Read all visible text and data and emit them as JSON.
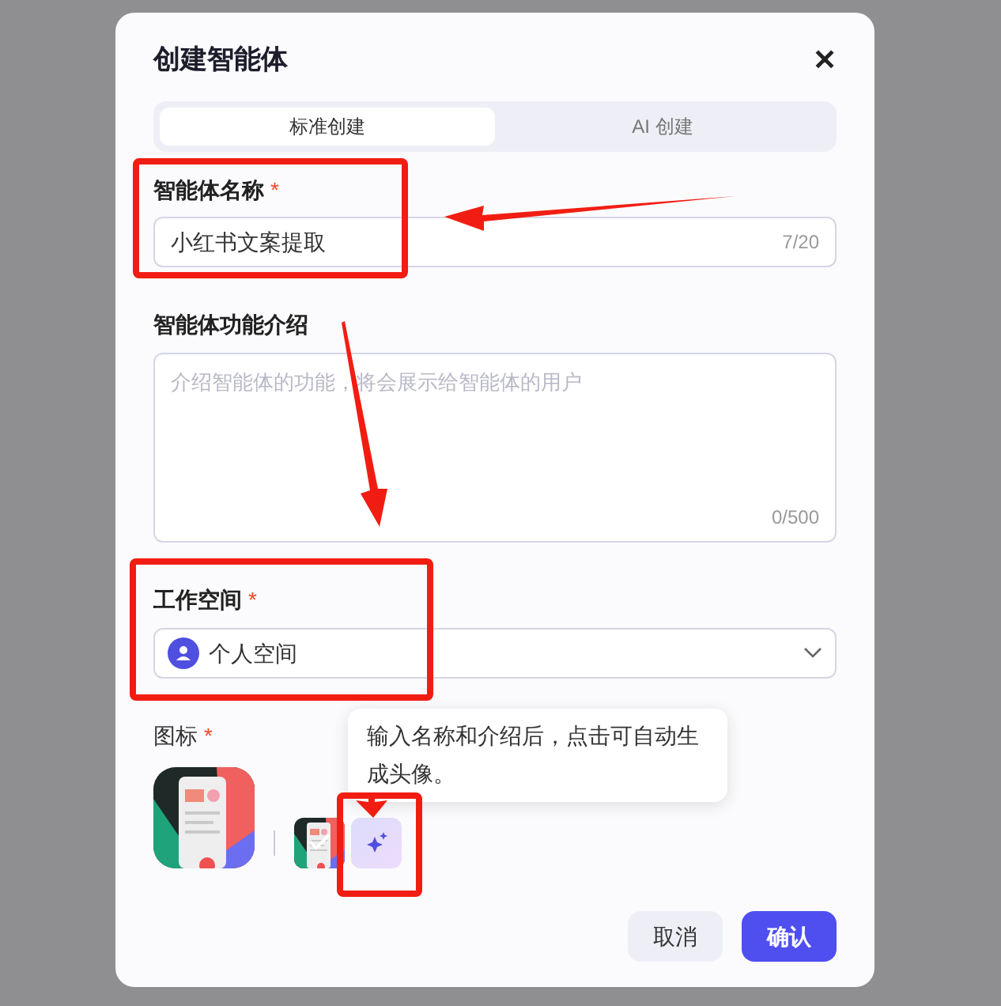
{
  "dialog": {
    "title": "创建智能体",
    "close": "✕"
  },
  "tabs": [
    {
      "label": "标准创建",
      "selected": true
    },
    {
      "label": "AI 创建",
      "selected": false
    }
  ],
  "name_field": {
    "label": "智能体名称",
    "required": "*",
    "value": "小红书文案提取",
    "count": "7/20"
  },
  "description_field": {
    "label": "智能体功能介绍",
    "placeholder": "介绍智能体的功能，将会展示给智能体的用户",
    "count": "0/500"
  },
  "workspace_field": {
    "label": "工作空间",
    "required": "*",
    "value": "个人空间"
  },
  "icon_field": {
    "label": "图标",
    "required": "*",
    "options": [
      {
        "kind": "picture",
        "selected": true
      },
      {
        "kind": "generate",
        "selected": false
      }
    ]
  },
  "tooltip": "输入名称和介绍后，点击可自动生成头像。",
  "buttons": [
    {
      "label": "取消",
      "kind": "secondary"
    },
    {
      "label": "确认",
      "kind": "primary"
    }
  ]
}
